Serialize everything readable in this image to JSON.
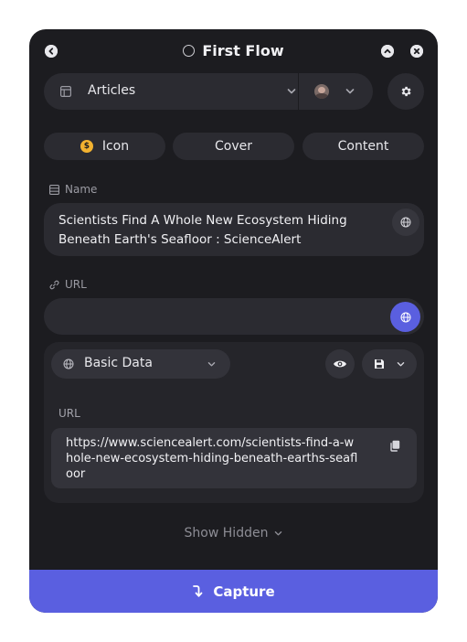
{
  "window": {
    "title": "First Flow"
  },
  "toolbar": {
    "database_label": "Articles"
  },
  "tabs": [
    {
      "label": "Icon"
    },
    {
      "label": "Cover"
    },
    {
      "label": "Content"
    }
  ],
  "name_field": {
    "label": "Name",
    "value": "Scientists Find A Whole New Ecosystem Hiding Beneath Earth's Seafloor : ScienceAlert"
  },
  "url_field": {
    "label": "URL",
    "value": ""
  },
  "data_card": {
    "source_label": "Basic Data",
    "url_label": "URL",
    "url_value": "https://www.sciencealert.com/scientists-find-a-whole-new-ecosystem-hiding-beneath-earths-seafloor"
  },
  "footer": {
    "show_hidden_label": "Show Hidden",
    "capture_label": "Capture"
  },
  "colors": {
    "panel_bg": "#1c1c20",
    "accent": "#5a5fe0",
    "icon_badge": "#f2b230"
  }
}
